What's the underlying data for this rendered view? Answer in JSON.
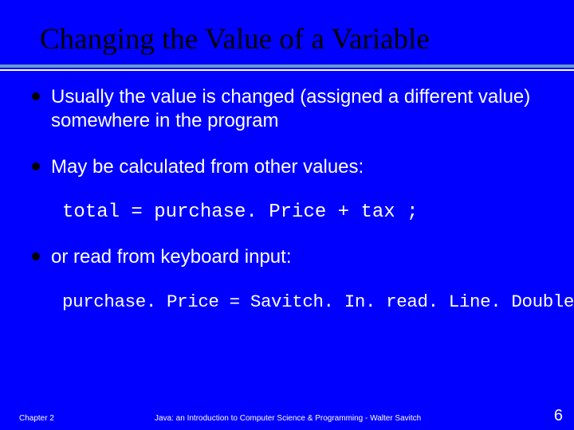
{
  "title": "Changing the Value of a Variable",
  "bullets": {
    "b1": "Usually the value is changed (assigned a different value) somewhere in the program",
    "b2": "May be calculated from other values:",
    "b3": "or read from keyboard input:"
  },
  "code": {
    "c1": "total = purchase. Price + tax ;",
    "c2": "purchase. Price = Savitch. In. read. Line. Double();"
  },
  "footer": {
    "left": "Chapter 2",
    "center": "Java: an Introduction to Computer Science & Programming - Walter Savitch",
    "right": "6"
  }
}
